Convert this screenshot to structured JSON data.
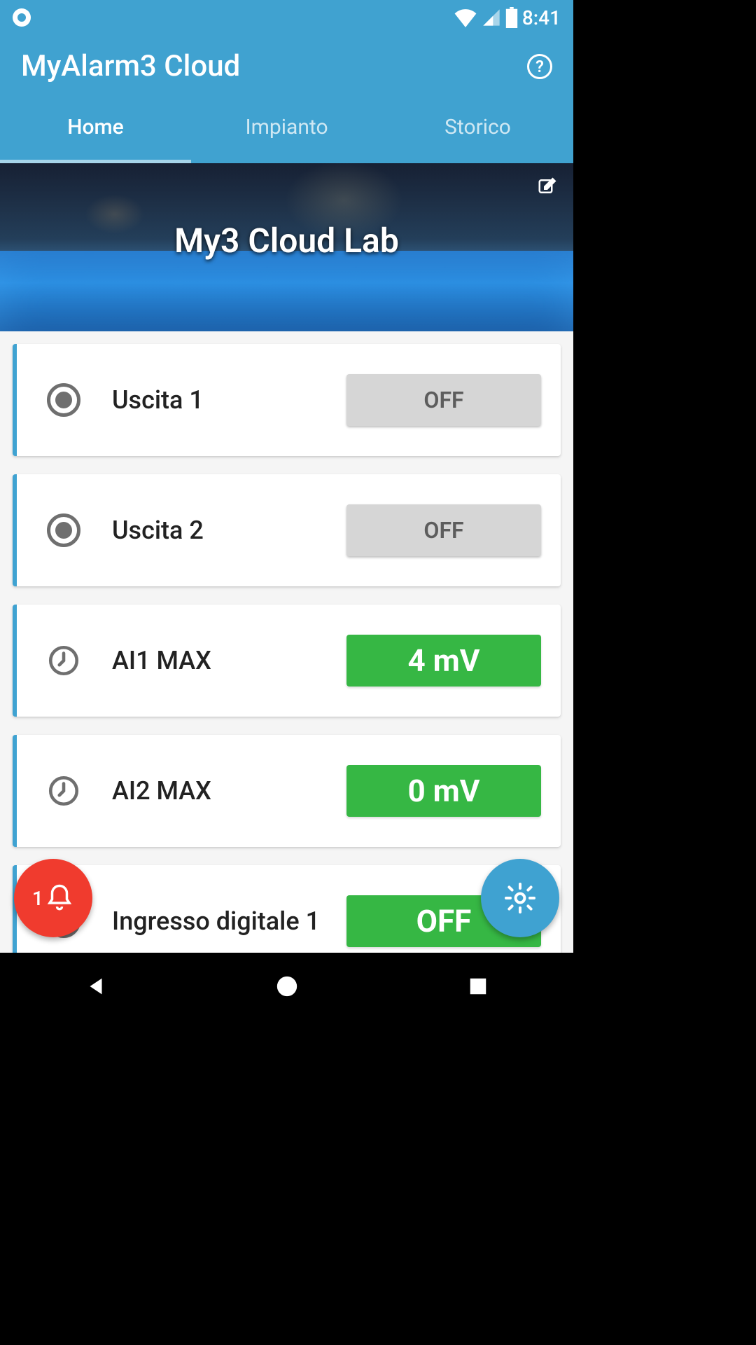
{
  "status": {
    "time": "8:41"
  },
  "header": {
    "title": "MyAlarm3 Cloud"
  },
  "tabs": [
    {
      "label": "Home",
      "active": true
    },
    {
      "label": "Impianto",
      "active": false
    },
    {
      "label": "Storico",
      "active": false
    }
  ],
  "hero": {
    "title": "My3 Cloud Lab"
  },
  "cards": [
    {
      "icon": "circle",
      "label": "Uscita 1",
      "value": "OFF",
      "style": "off"
    },
    {
      "icon": "circle",
      "label": "Uscita 2",
      "value": "OFF",
      "style": "off"
    },
    {
      "icon": "timer",
      "label": "AI1 MAX",
      "value": "4 mV",
      "style": "green"
    },
    {
      "icon": "timer",
      "label": "AI2 MAX",
      "value": "0 mV",
      "style": "green"
    },
    {
      "icon": "circle",
      "label": "Ingresso digitale 1",
      "value": "OFF",
      "style": "green-off"
    }
  ],
  "fab": {
    "notification_count": "1"
  }
}
